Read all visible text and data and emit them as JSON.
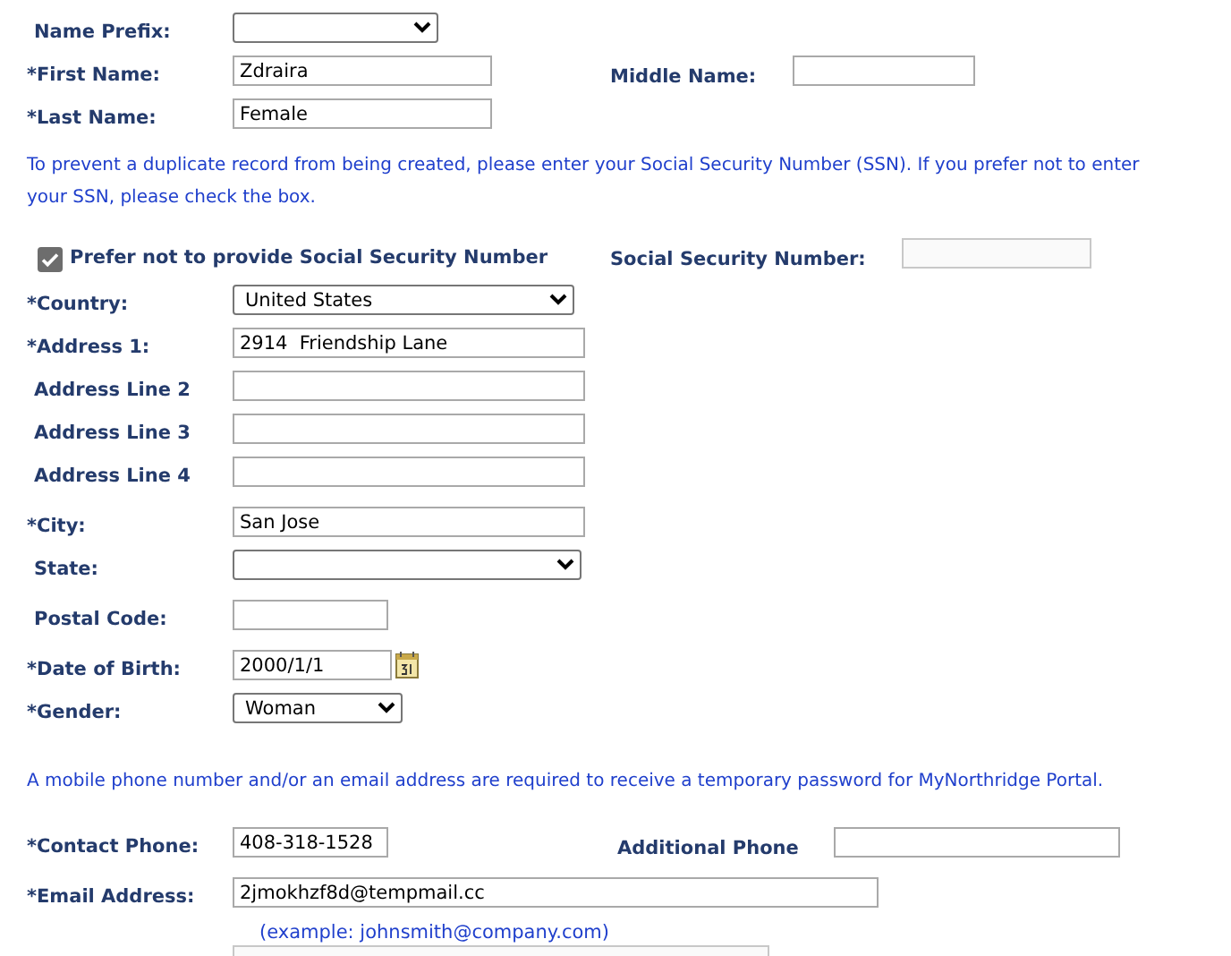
{
  "rows": [
    {
      "kind": "field",
      "label": "Name Prefix:",
      "required": false,
      "control": {
        "kind": "select"
      }
    },
    {
      "kind": "field",
      "label": "*First Name:",
      "required": true,
      "control": {
        "kind": "text",
        "value": "Zdraira"
      },
      "right": {
        "label": "Middle Name:",
        "control": {
          "kind": "text"
        }
      }
    },
    {
      "kind": "field",
      "label": "*Last Name:",
      "required": true,
      "control": {
        "kind": "text",
        "value": "Female"
      }
    },
    {
      "kind": "note",
      "text": "To prevent a duplicate record from being created, please enter your Social Security Number (SSN). If you prefer not to enter your SSN, please check the box."
    },
    {
      "kind": "checkbox",
      "label": "Prefer not to provide Social Security Number",
      "checked": true,
      "right": {
        "label": "Social Security Number:",
        "control": {
          "kind": "text",
          "disabled": true
        }
      }
    },
    {
      "kind": "field",
      "label": "*Country:",
      "required": true,
      "control": {
        "kind": "select",
        "value": "United States"
      }
    },
    {
      "kind": "field",
      "label": "*Address 1:",
      "required": true,
      "control": {
        "kind": "text",
        "value": "2914  Friendship Lane"
      }
    },
    {
      "kind": "field",
      "label": "Address Line 2",
      "required": false,
      "control": {
        "kind": "text"
      }
    },
    {
      "kind": "field",
      "label": "Address Line 3",
      "required": false,
      "control": {
        "kind": "text"
      }
    },
    {
      "kind": "field",
      "label": "Address Line 4",
      "required": false,
      "control": {
        "kind": "text"
      }
    },
    {
      "kind": "field",
      "label": "*City:",
      "required": true,
      "control": {
        "kind": "text",
        "value": "San Jose"
      }
    },
    {
      "kind": "field",
      "label": "State:",
      "required": false,
      "control": {
        "kind": "select"
      }
    },
    {
      "kind": "field",
      "label": "Postal Code:",
      "required": false,
      "control": {
        "kind": "text"
      }
    },
    {
      "kind": "field",
      "label": "*Date of Birth:",
      "required": true,
      "control": {
        "kind": "date",
        "value": "2000/1/1"
      }
    },
    {
      "kind": "field",
      "label": "*Gender:",
      "required": true,
      "control": {
        "kind": "select",
        "value": "Woman"
      }
    },
    {
      "kind": "note",
      "text": "A mobile phone number and/or an email address are required to receive a temporary password for MyNorthridge Portal."
    },
    {
      "kind": "field",
      "label": "*Contact Phone:",
      "required": true,
      "control": {
        "kind": "text",
        "value": "408-318-1528"
      },
      "right": {
        "label": "Additional Phone",
        "control": {
          "kind": "text"
        }
      }
    },
    {
      "kind": "field",
      "label": "*Email Address:",
      "required": true,
      "control": {
        "kind": "text",
        "value": "2jmokhzf8d@tempmail.cc"
      }
    },
    {
      "kind": "hint",
      "text": "(example: johnsmith@company.com)"
    },
    {
      "kind": "field",
      "control": {
        "kind": "text",
        "disabled": true
      }
    }
  ]
}
